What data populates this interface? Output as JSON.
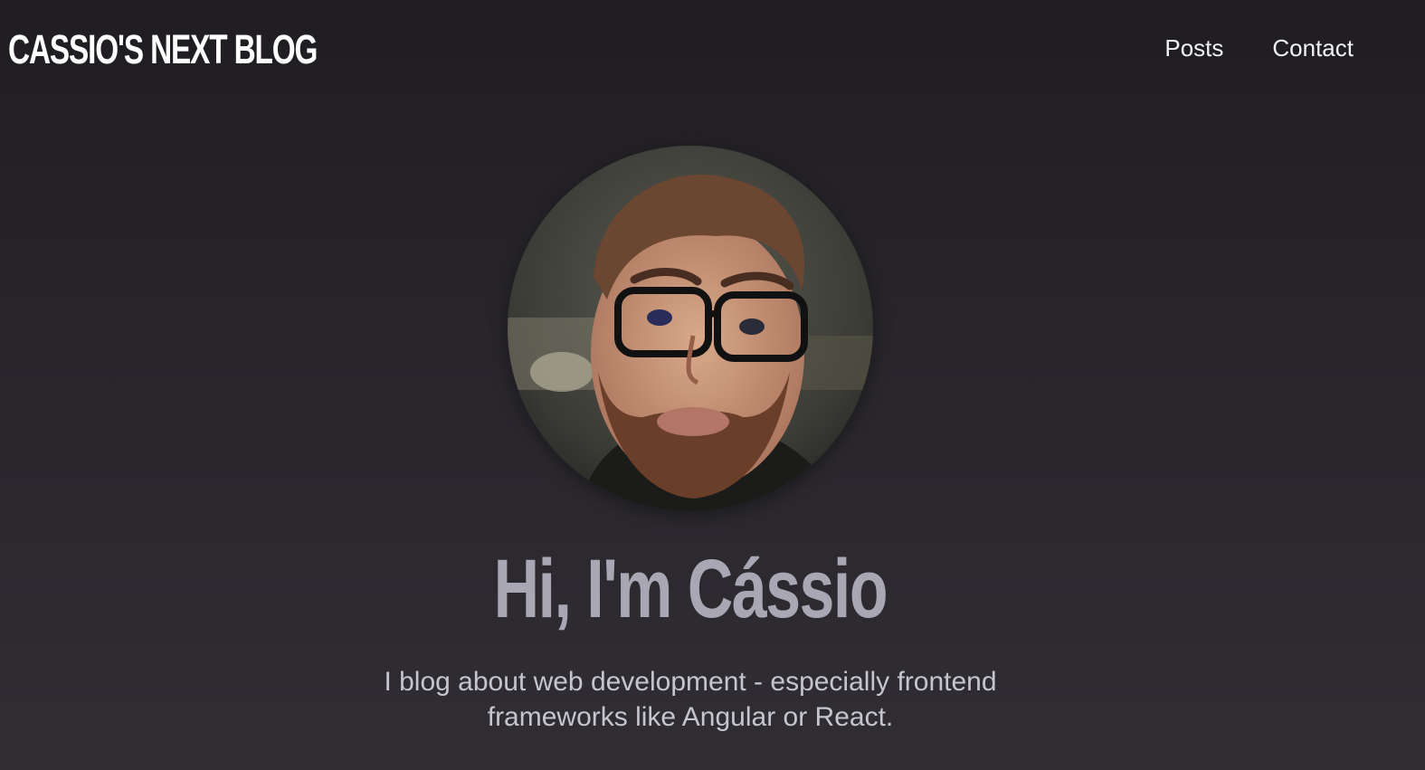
{
  "header": {
    "logo": "CASSIO'S NEXT BLOG",
    "nav": {
      "posts": "Posts",
      "contact": "Contact"
    }
  },
  "hero": {
    "avatar_alt": "Cássio",
    "title": "Hi, I'm Cássio",
    "description": "I blog about web development - especially frontend frameworks like Angular or React."
  },
  "colors": {
    "background_top": "#1f1d21",
    "background_bottom": "#302d33",
    "logo": "#ffffff",
    "nav_text": "#f2f1f4",
    "title": "#a9a7b4",
    "description": "#c6c4cd"
  }
}
